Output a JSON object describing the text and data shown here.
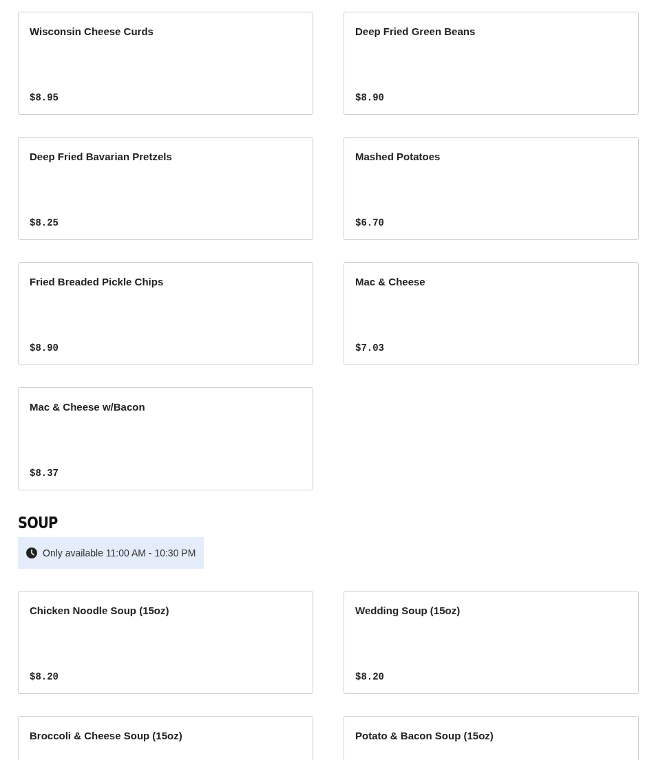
{
  "sections": [
    {
      "items": [
        {
          "name": "Wisconsin Cheese Curds",
          "price": "$8.95"
        },
        {
          "name": "Deep Fried Green Beans",
          "price": "$8.90"
        },
        {
          "name": "Deep Fried Bavarian Pretzels",
          "price": "$8.25"
        },
        {
          "name": "Mashed Potatoes",
          "price": "$6.70"
        },
        {
          "name": "Fried Breaded Pickle Chips",
          "price": "$8.90"
        },
        {
          "name": "Mac & Cheese",
          "price": "$7.03"
        },
        {
          "name": "Mac & Cheese w/Bacon",
          "price": "$8.37"
        }
      ]
    },
    {
      "heading": "SOUP",
      "availability": "Only available 11:00 AM - 10:30 PM",
      "items": [
        {
          "name": "Chicken Noodle Soup (15oz)",
          "price": "$8.20"
        },
        {
          "name": "Wedding Soup (15oz)",
          "price": "$8.20"
        },
        {
          "name": "Broccoli & Cheese Soup (15oz)"
        },
        {
          "name": "Potato & Bacon Soup (15oz)"
        }
      ]
    }
  ]
}
